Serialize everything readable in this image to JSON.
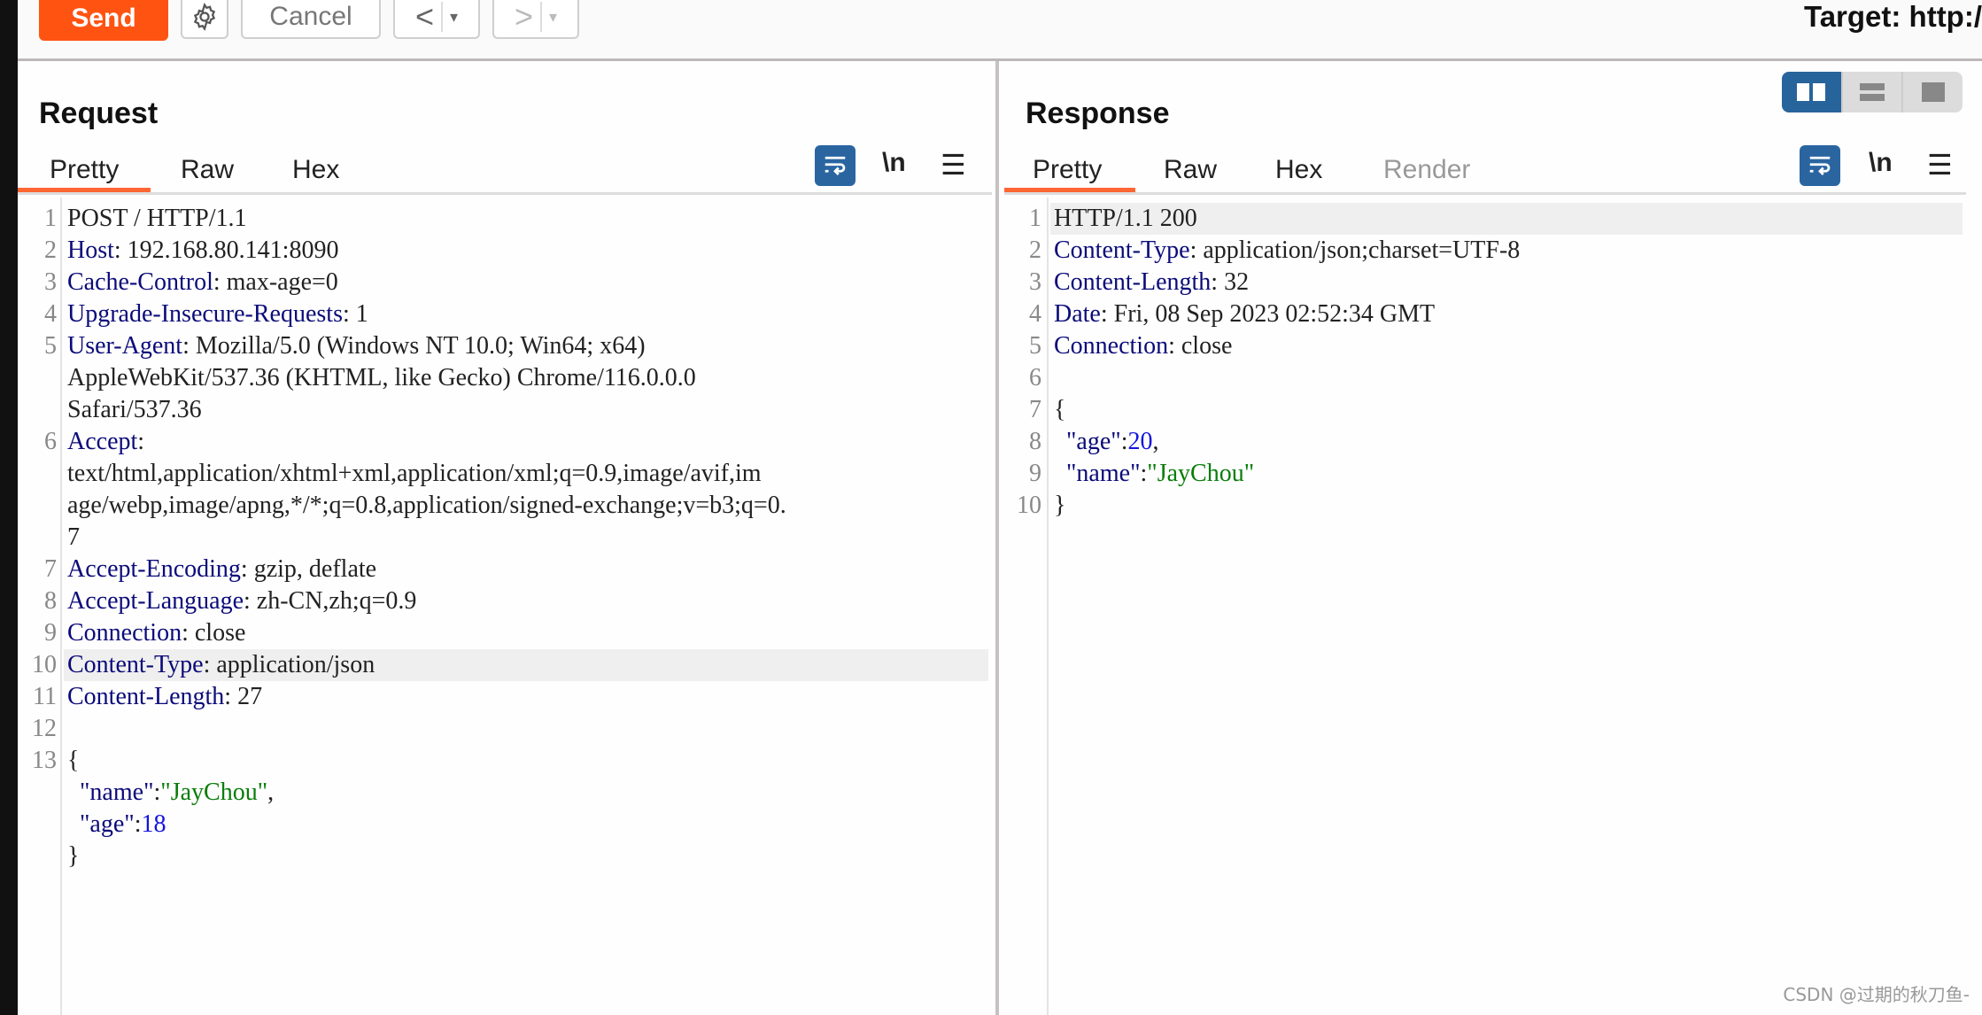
{
  "toolbar": {
    "send_label": "Send",
    "cancel_label": "Cancel",
    "back_label": "<",
    "forward_label": ">",
    "dropdown_glyph": "▾",
    "target_label": "Target: http:/"
  },
  "request": {
    "title": "Request",
    "tabs": [
      "Pretty",
      "Raw",
      "Hex"
    ],
    "active_tab": "Pretty",
    "newline_label": "\\n",
    "lines": [
      {
        "n": "1",
        "parts": [
          [
            "t",
            "POST / HTTP/1.1"
          ]
        ]
      },
      {
        "n": "2",
        "parts": [
          [
            "k",
            "Host"
          ],
          [
            "t",
            ": 192.168.80.141:8090"
          ]
        ]
      },
      {
        "n": "3",
        "parts": [
          [
            "k",
            "Cache-Control"
          ],
          [
            "t",
            ": max-age=0"
          ]
        ]
      },
      {
        "n": "4",
        "parts": [
          [
            "k",
            "Upgrade-Insecure-Requests"
          ],
          [
            "t",
            ": 1"
          ]
        ]
      },
      {
        "n": "5",
        "parts": [
          [
            "k",
            "User-Agent"
          ],
          [
            "t",
            ": Mozilla/5.0 (Windows NT 10.0; Win64; x64)"
          ]
        ]
      },
      {
        "n": "",
        "parts": [
          [
            "t",
            "AppleWebKit/537.36 (KHTML, like Gecko) Chrome/116.0.0.0"
          ]
        ]
      },
      {
        "n": "",
        "parts": [
          [
            "t",
            "Safari/537.36"
          ]
        ]
      },
      {
        "n": "6",
        "parts": [
          [
            "k",
            "Accept"
          ],
          [
            "t",
            ":"
          ]
        ]
      },
      {
        "n": "",
        "parts": [
          [
            "t",
            "text/html,application/xhtml+xml,application/xml;q=0.9,image/avif,im"
          ]
        ]
      },
      {
        "n": "",
        "parts": [
          [
            "t",
            "age/webp,image/apng,*/*;q=0.8,application/signed-exchange;v=b3;q=0."
          ]
        ]
      },
      {
        "n": "",
        "parts": [
          [
            "t",
            "7"
          ]
        ]
      },
      {
        "n": "7",
        "parts": [
          [
            "k",
            "Accept-Encoding"
          ],
          [
            "t",
            ": gzip, deflate"
          ]
        ]
      },
      {
        "n": "8",
        "parts": [
          [
            "k",
            "Accept-Language"
          ],
          [
            "t",
            ": zh-CN,zh;q=0.9"
          ]
        ]
      },
      {
        "n": "9",
        "parts": [
          [
            "k",
            "Connection"
          ],
          [
            "t",
            ": close"
          ]
        ]
      },
      {
        "n": "10",
        "parts": [
          [
            "k",
            "Content-Type"
          ],
          [
            "t",
            ": application/json"
          ]
        ],
        "highlight": true
      },
      {
        "n": "11",
        "parts": [
          [
            "k",
            "Content-Length"
          ],
          [
            "t",
            ": 27"
          ]
        ]
      },
      {
        "n": "12",
        "parts": []
      },
      {
        "n": "13",
        "parts": [
          [
            "t",
            "{"
          ]
        ]
      },
      {
        "n": "",
        "parts": [
          [
            "t",
            "  "
          ],
          [
            "k",
            "\"name\""
          ],
          [
            "t",
            ":"
          ],
          [
            "s",
            "\"JayChou\""
          ],
          [
            "t",
            ","
          ]
        ]
      },
      {
        "n": "",
        "parts": [
          [
            "t",
            "  "
          ],
          [
            "k",
            "\"age\""
          ],
          [
            "t",
            ":"
          ],
          [
            "n",
            "18"
          ]
        ]
      },
      {
        "n": "",
        "parts": [
          [
            "t",
            "}"
          ]
        ]
      }
    ]
  },
  "response": {
    "title": "Response",
    "tabs": [
      "Pretty",
      "Raw",
      "Hex",
      "Render"
    ],
    "active_tab": "Pretty",
    "disabled_tabs": [
      "Render"
    ],
    "newline_label": "\\n",
    "lines": [
      {
        "n": "1",
        "parts": [
          [
            "t",
            "HTTP/1.1 200"
          ]
        ],
        "highlight": true
      },
      {
        "n": "2",
        "parts": [
          [
            "k",
            "Content-Type"
          ],
          [
            "t",
            ": application/json;charset=UTF-8"
          ]
        ]
      },
      {
        "n": "3",
        "parts": [
          [
            "k",
            "Content-Length"
          ],
          [
            "t",
            ": 32"
          ]
        ]
      },
      {
        "n": "4",
        "parts": [
          [
            "k",
            "Date"
          ],
          [
            "t",
            ": Fri, 08 Sep 2023 02:52:34 GMT"
          ]
        ]
      },
      {
        "n": "5",
        "parts": [
          [
            "k",
            "Connection"
          ],
          [
            "t",
            ": close"
          ]
        ]
      },
      {
        "n": "6",
        "parts": []
      },
      {
        "n": "7",
        "parts": [
          [
            "t",
            "{"
          ]
        ]
      },
      {
        "n": "8",
        "parts": [
          [
            "t",
            "  "
          ],
          [
            "k",
            "\"age\""
          ],
          [
            "t",
            ":"
          ],
          [
            "n",
            "20"
          ],
          [
            "t",
            ","
          ]
        ]
      },
      {
        "n": "9",
        "parts": [
          [
            "t",
            "  "
          ],
          [
            "k",
            "\"name\""
          ],
          [
            "t",
            ":"
          ],
          [
            "s",
            "\"JayChou\""
          ]
        ]
      },
      {
        "n": "10",
        "parts": [
          [
            "t",
            "}"
          ]
        ]
      }
    ]
  },
  "layout_toggle": {
    "options": [
      "side-by-side",
      "top-bottom",
      "single"
    ],
    "active": "side-by-side"
  },
  "colors": {
    "send": "#ff5311",
    "accent_blue": "#28649c",
    "tab_underline": "#ff6633",
    "header_key": "#0b0b7a",
    "json_string": "#0a7d0a",
    "json_number": "#1414e0"
  },
  "watermark": "CSDN @过期的秋刀鱼-"
}
